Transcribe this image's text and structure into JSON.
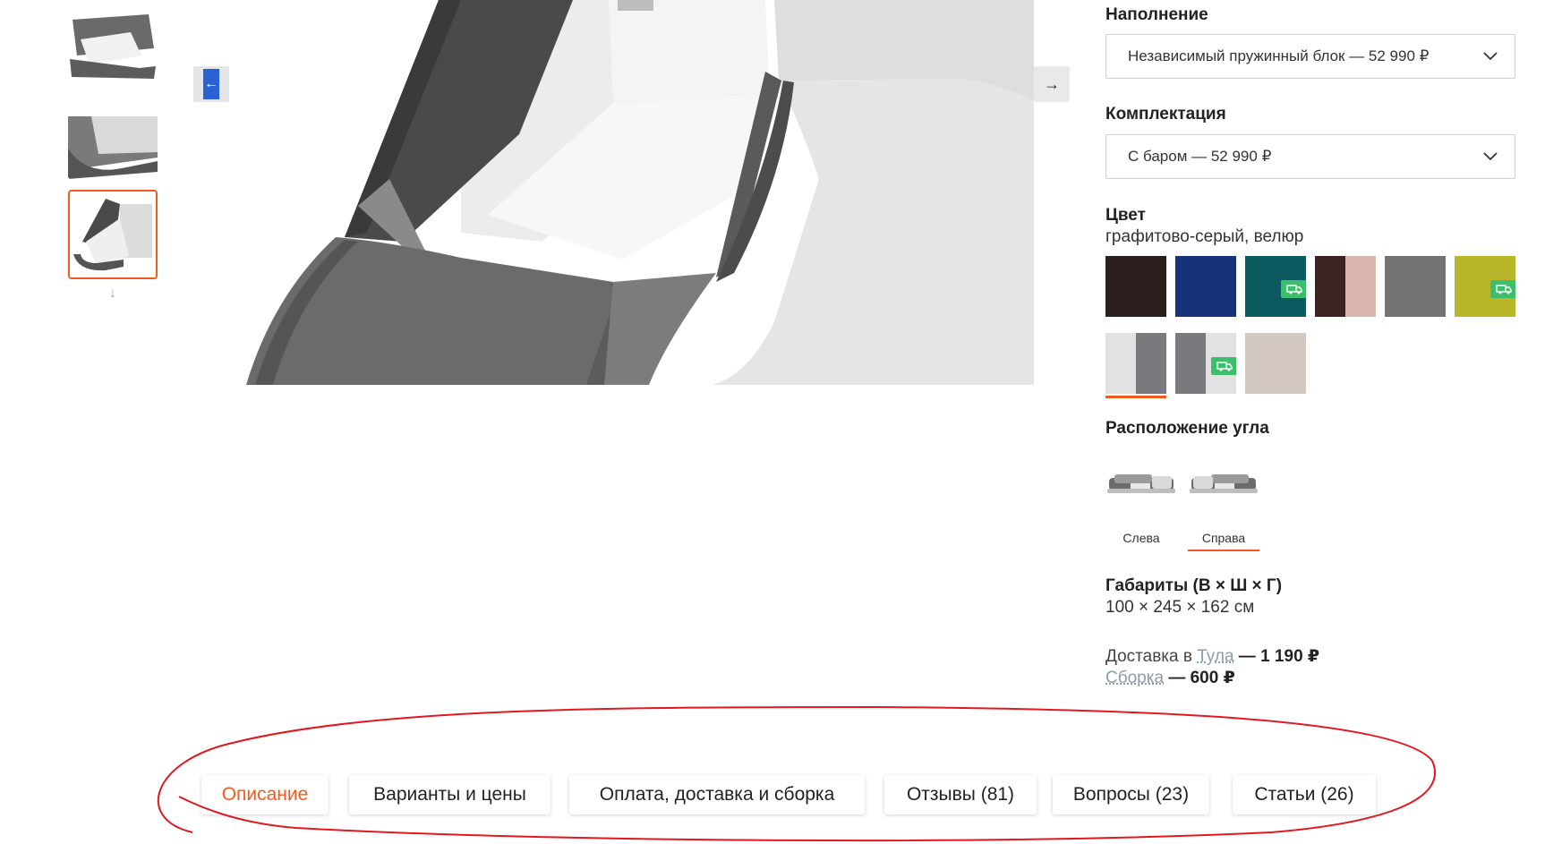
{
  "gallery": {
    "prev_icon": "arrow-left-icon",
    "next_icon": "arrow-right-icon",
    "thumbs_down_icon": "arrow-down-icon"
  },
  "options": {
    "filling": {
      "label": "Наполнение",
      "value": "Независимый пружинный блок — 52 990 ₽"
    },
    "config": {
      "label": "Комплектация",
      "value": "С баром — 52 990 ₽"
    },
    "color": {
      "label": "Цвет",
      "selected_name": "графитово-серый, велюр",
      "swatches": [
        {
          "colors": [
            "#2a1f1c"
          ],
          "badge": false
        },
        {
          "colors": [
            "#16337a"
          ],
          "badge": false
        },
        {
          "colors": [
            "#0b5a60"
          ],
          "badge": true
        },
        {
          "colors": [
            "#3a2320",
            "#d9b6ad"
          ],
          "badge": false
        },
        {
          "colors": [
            "#737373"
          ],
          "badge": false
        },
        {
          "colors": [
            "#b8b62a"
          ],
          "badge": true
        },
        {
          "colors": [
            "#e2e2e2",
            "#7a7a7e"
          ],
          "badge": false,
          "selected": true
        },
        {
          "colors": [
            "#7a7a7e",
            "#e2e2e2"
          ],
          "badge": true
        },
        {
          "colors": [
            "#d3c8c2"
          ],
          "badge": false
        }
      ],
      "badge_icon": "delivery-truck-icon",
      "accent": "#f25a1d"
    },
    "corner": {
      "label": "Расположение угла",
      "left_label": "Слева",
      "right_label": "Справа",
      "selected": "Справа"
    },
    "dimensions": {
      "label": "Габариты (В × Ш × Г)",
      "value": "100 × 245 × 162 см"
    },
    "delivery": {
      "prefix": "Доставка в ",
      "city": "Тула",
      "price": " — 1 190 ₽",
      "assembly_link": "Сборка",
      "assembly_price": " — 600 ₽"
    }
  },
  "tabs": [
    {
      "label": "Описание",
      "active": true
    },
    {
      "label": "Варианты и цены"
    },
    {
      "label": "Оплата, доставка и сборка"
    },
    {
      "label": "Отзывы (81)"
    },
    {
      "label": "Вопросы (23)"
    },
    {
      "label": "Статьи (26)"
    }
  ],
  "annotation_color": "#e0191f"
}
